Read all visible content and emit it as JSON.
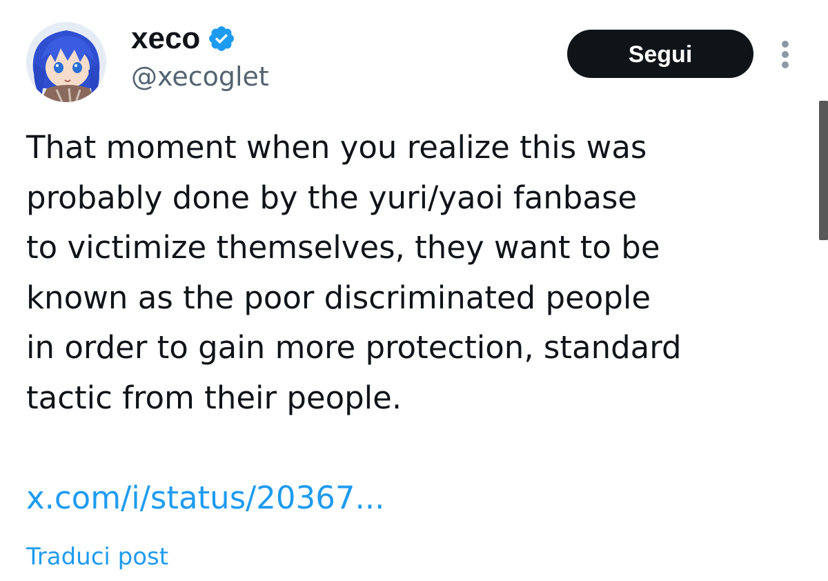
{
  "author": {
    "display_name": "xeco",
    "handle": "@xecoglet",
    "verified": true
  },
  "actions": {
    "follow_label": "Segui"
  },
  "tweet": {
    "lines": [
      "That moment when you realize this was",
      "probably done by the yuri/yaoi fanbase",
      "to victimize themselves, they want to be",
      "known as the poor discriminated people",
      "in order to gain more protection, standard",
      "tactic from their people."
    ],
    "link": "x.com/i/status/20367...",
    "translate_label": "Traduci post"
  },
  "colors": {
    "link": "#1d9bf0",
    "verified_badge": "#1d9bf0",
    "follow_button_bg": "#0f1419",
    "secondary_text": "#536471"
  },
  "icons": {
    "verified": "verified-badge-icon",
    "more": "more-vertical-icon"
  }
}
